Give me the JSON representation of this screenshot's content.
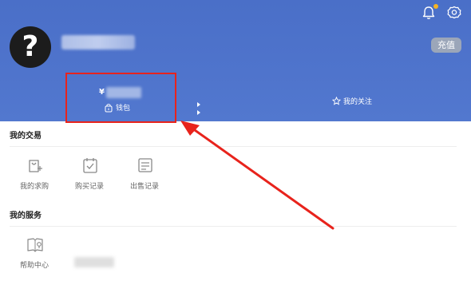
{
  "header": {
    "avatar_glyph": "?",
    "recharge_label": "充值"
  },
  "wallet": {
    "currency": "¥",
    "label": "钱包"
  },
  "follow": {
    "label": "我的关注"
  },
  "trade": {
    "title": "我的交易",
    "items": [
      {
        "label": "我的求购",
        "icon": "shopping-bag-plus-icon"
      },
      {
        "label": "购买记录",
        "icon": "calendar-check-icon"
      },
      {
        "label": "出售记录",
        "icon": "sales-record-icon"
      }
    ]
  },
  "service": {
    "title": "我的服务",
    "items": [
      {
        "label": "帮助中心",
        "icon": "help-book-icon"
      }
    ]
  },
  "colors": {
    "header_bg": "#4f74cc",
    "annotation": "#e8231c",
    "badge_dot": "#f5b324",
    "recharge_bg": "#9ba6b9"
  }
}
